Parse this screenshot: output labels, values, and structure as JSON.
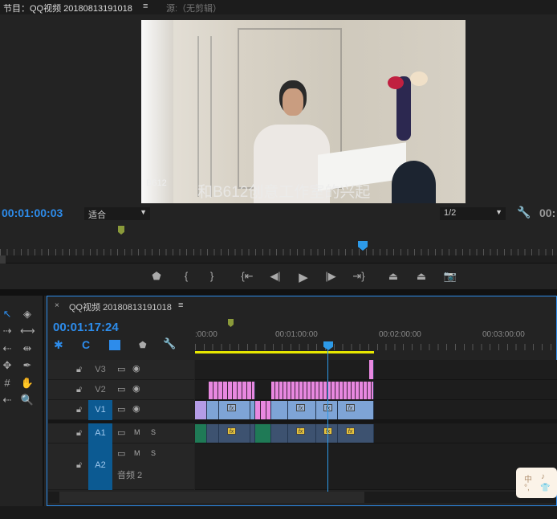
{
  "program_monitor": {
    "tab_title": "节目：QQ视频 20180813191018",
    "menu_icon": "≡",
    "source_tab": "源:（无剪辑）",
    "subtitle": "和B612创意工作室的兴起",
    "watermark": "B612",
    "timecode": "00:01:00:03",
    "zoom_select": "适合",
    "resolution_select": "1/2",
    "duration_partial": "00:"
  },
  "transport": [
    "add-marker",
    "mark-in",
    "mark-out",
    "go-to-in",
    "step-back",
    "play",
    "step-forward",
    "go-to-out",
    "lift",
    "extract",
    "export-frame"
  ],
  "timeline": {
    "close": "×",
    "sequence_name": "QQ视频 20180813191018",
    "menu_icon": "≡",
    "timecode": "00:01:17:24",
    "ruler_labels": [
      ":00:00",
      "00:01:00:00",
      "00:02:00:00",
      "00:03:00:00"
    ],
    "tracks": [
      {
        "id": "V3"
      },
      {
        "id": "V2"
      },
      {
        "id": "V1"
      },
      {
        "id": "A1",
        "m": "M",
        "s": "S"
      },
      {
        "id": "A2",
        "m": "M",
        "s": "S",
        "name": "音频 2"
      }
    ],
    "fx_label": "fx"
  },
  "ime_widget": {
    "chars": [
      "中",
      "♪",
      "°,",
      "👕"
    ]
  },
  "colors": {
    "accent": "#2d8ceb",
    "video_clip": "#7ea4d6",
    "audio_clip": "#3d5270",
    "pink": "#e888e0",
    "work_area": "#e8e800"
  }
}
